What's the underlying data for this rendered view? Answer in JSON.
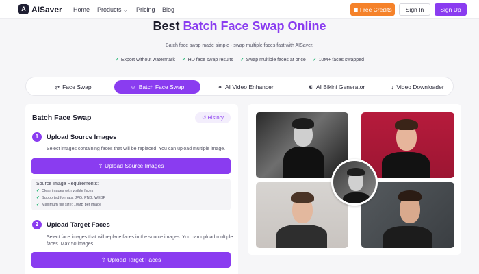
{
  "nav": {
    "logo_mark": "A",
    "brand": "AISaver",
    "links": [
      "Home",
      "Products",
      "Pricing",
      "Blog"
    ],
    "free_credits": "Free Credits",
    "sign_in": "Sign In",
    "sign_up": "Sign Up"
  },
  "hero": {
    "title_plain": "Best ",
    "title_accent": "Batch Face Swap Online",
    "subtitle": "Batch face swap made simple - swap multiple faces fast with AISaver.",
    "features": [
      "Export without watermark",
      "HD face swap results",
      "Swap multiple faces at once",
      "10M+ faces swapped"
    ]
  },
  "tabs": [
    {
      "label": "Face Swap",
      "icon": "shuffle-icon"
    },
    {
      "label": "Batch Face Swap",
      "icon": "users-icon"
    },
    {
      "label": "AI Video Enhancer",
      "icon": "sparkle-icon"
    },
    {
      "label": "AI Bikini Generator",
      "icon": "bikini-icon"
    },
    {
      "label": "Video Downloader",
      "icon": "download-icon"
    }
  ],
  "panel": {
    "title": "Batch Face Swap",
    "history": "History",
    "step1": {
      "num": "1",
      "title": "Upload Source Images",
      "desc": "Select images containing faces that will be replaced. You can upload multiple image.",
      "button": "Upload Source Images"
    },
    "requirements": {
      "title": "Source Image Requirements:",
      "items": [
        "Clear images with visible faces",
        "Supported formats: JPG, PNG, WEBP",
        "Maximum file size: 10MB per image"
      ]
    },
    "step2": {
      "num": "2",
      "title": "Upload Target Faces",
      "desc": "Select face images that will replace faces in the source images. You can upload multiple faces. Max 50 images.",
      "button": "Upload Target Faces"
    }
  },
  "colors": {
    "accent": "#8a3cf0",
    "orange": "#f5822a",
    "check": "#22b573"
  }
}
